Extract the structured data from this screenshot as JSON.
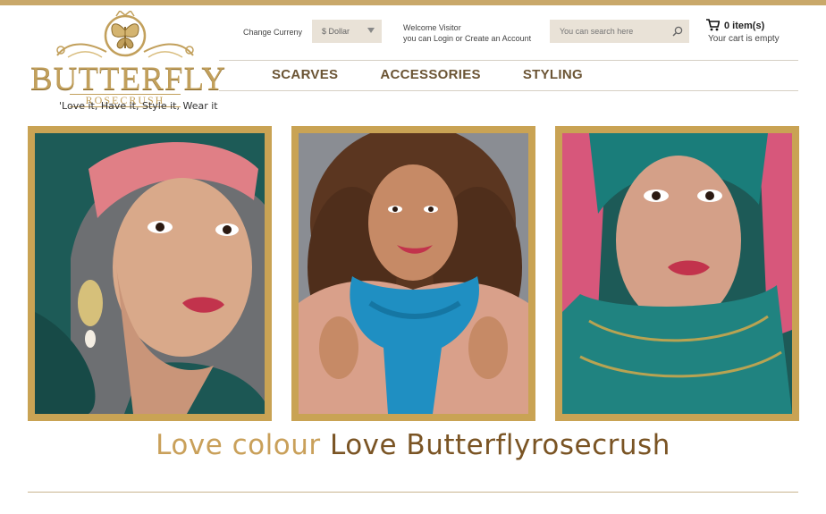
{
  "brand": {
    "logo_word": "BUTTERFLY",
    "logo_sub": "ROSECRUSH",
    "tagline": "'Love it, Have it, Style it, Wear it"
  },
  "currency": {
    "label": "Change Curreny",
    "selected": "$  Dollar"
  },
  "account": {
    "welcome": "Welcome Visitor",
    "login_prompt": "you can Login or Create an Account"
  },
  "search": {
    "placeholder": "You can search here"
  },
  "cart": {
    "count": "0 item(s)",
    "status": "Your cart is empty"
  },
  "nav": {
    "items": [
      "SCARVES",
      "ACCESSORIES",
      "STYLING"
    ]
  },
  "gallery": {
    "images": [
      "model-pink-teal-headscarf",
      "model-blue-scarf",
      "model-teal-pink-headscarf"
    ]
  },
  "slogan": {
    "part1": "Love colour",
    "part2": "Love Butterflyrosecrush"
  },
  "colors": {
    "gold": "#c9a354",
    "brown": "#6b5434",
    "accent_light": "#c9a05a",
    "accent_dark": "#7a5424"
  }
}
